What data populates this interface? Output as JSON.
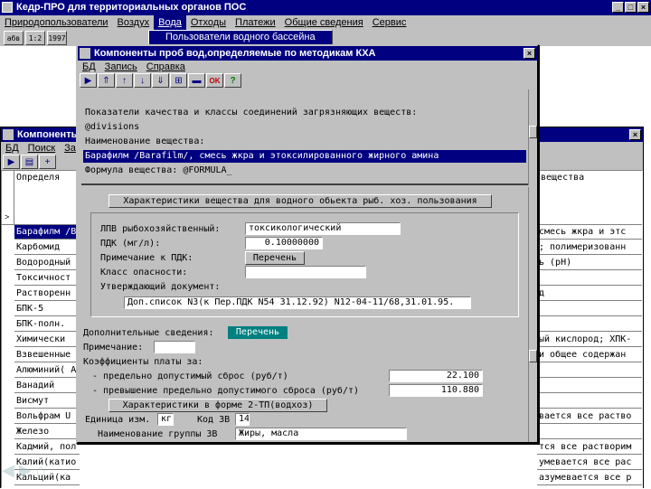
{
  "app": {
    "title": "Кедр-ПРО для территориальных органов ПОС",
    "menu": [
      "Природопользователи",
      "Воздух",
      "Вода",
      "Отходы",
      "Платежи",
      "Общие сведения",
      "Сервис"
    ],
    "toolbar": [
      "абв",
      "1:2",
      "1997"
    ],
    "dropdown_item": "Пользователи водного бассейна"
  },
  "back_window": {
    "title": "Компоненты",
    "menu": [
      "БД",
      "Поиск",
      "За"
    ],
    "col_header_left": "Определя",
    "col_header_right": "вещества",
    "rows_left": [
      "Барафилм /В",
      "Карбомид",
      "Водородный",
      "Токсичност",
      "Растворенн",
      "БПК-5",
      "БПК-полн.",
      "Химически",
      "Взвешенные",
      "Алюминий( А",
      "Ванадий",
      "Висмут",
      "Вольфрам U",
      "Железо",
      "Кадмий, пол",
      "Калий(катио",
      "Кальций(ка"
    ],
    "rows_right": [
      "смесь жкра и этс",
      "; полимеризованн",
      "ь (рН)",
      "",
      "д",
      "",
      "",
      "ый кислород; ХПК-",
      "и общее содержан",
      "",
      "",
      "",
      "вается все раство",
      "",
      "тся все растворим",
      "умевается все рас",
      "азумевается все р"
    ]
  },
  "dialog": {
    "title": "Компоненты проб вод,определяемые по методикам КХА",
    "menu": [
      "БД",
      "Запись",
      "Справка"
    ],
    "toolbar_icons": [
      "nav-first-icon",
      "nav-prev-page-icon",
      "nav-prev-icon",
      "nav-next-icon",
      "nav-last-icon",
      "add-record-icon",
      "delete-record-icon",
      "ok-icon",
      "help-icon"
    ],
    "ok_label": "OK",
    "help_label": "?",
    "info_lines": {
      "heading": "Показатели качества и классы соединений загрязняющих веществ:",
      "divisions": "@divisions",
      "name_label": "Наименование вещества:",
      "name_value": "Барафилм /Barafilm/, смесь жкра и этоксилированного жирного амина",
      "formula": "Формула вещества: @FORMULA_"
    },
    "section_button": "Характеристики вещества для водного обьекта рыб. хоз. пользования",
    "fields": {
      "lpv_label": "ЛПВ рыбохозяйственный:",
      "lpv_value": "токсикологический",
      "pdk_label": "ПДК (мг/л):",
      "pdk_value": "0.10000000",
      "note_label": "Примечание к ПДК:",
      "note_button": "Перечень",
      "hazard_label": "Класс опасности:",
      "hazard_value": "",
      "doc_label": "Утверждающий документ:",
      "doc_value": "Доп.список N3(к Пер.ПДК N54 31.12.92) N12-04-11/68,31.01.95."
    },
    "extra_label": "Дополнительные сведения:",
    "extra_button": "Перечень",
    "note2_label": "Примечание:",
    "coef_label": "Коэффициенты платы за:",
    "limit_label": "- предельно допустимый сброс (руб/т)",
    "limit_value": "22.100",
    "excess_label": "- превышение предельно допустимого сброса (руб/т)",
    "excess_value": "110.880",
    "form_button": "Характеристики в форме 2-ТП(водхоз)",
    "unit_label": "Единица изм.",
    "unit_value": "кг",
    "code_label": "Код ЗВ",
    "code_value": "14",
    "group_label": "Наименование группы ЗВ",
    "group_value": "Жиры, масла"
  },
  "colors": {
    "title_bg": "#000080",
    "face": "#c0c0c0",
    "highlight_row": "#000080",
    "highlight_text": "#ffffff",
    "teal_button": "#008080"
  }
}
